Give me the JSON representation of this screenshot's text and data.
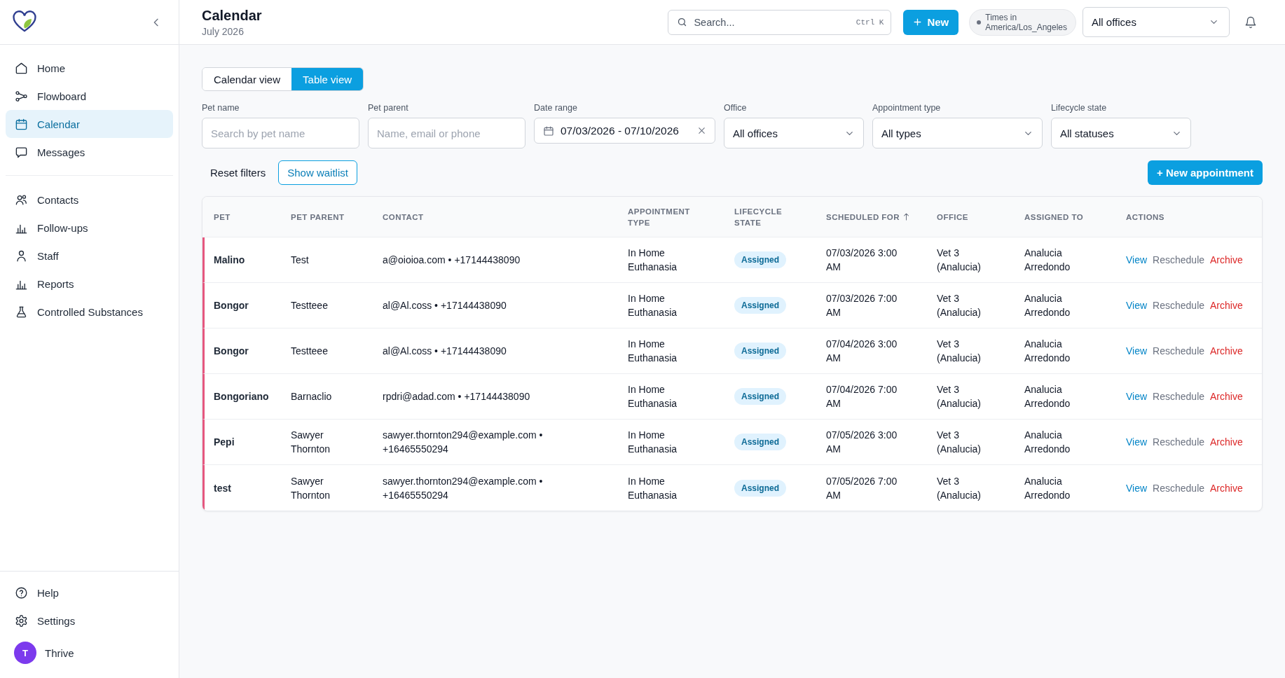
{
  "sidebar": {
    "sections": [
      {
        "items": [
          {
            "label": "Home",
            "selected": false
          },
          {
            "label": "Flowboard",
            "selected": false
          },
          {
            "label": "Calendar",
            "selected": true
          },
          {
            "label": "Messages",
            "selected": false
          }
        ]
      },
      {
        "items": [
          {
            "label": "Contacts",
            "selected": false
          },
          {
            "label": "Follow-ups",
            "selected": false
          },
          {
            "label": "Staff",
            "selected": false
          },
          {
            "label": "Reports",
            "selected": false
          },
          {
            "label": "Controlled Substances",
            "selected": false
          }
        ]
      }
    ],
    "footer_items": [
      {
        "label": "Help",
        "selected": false
      },
      {
        "label": "Settings",
        "selected": false
      }
    ],
    "user": {
      "initial": "T",
      "name": "Thrive"
    }
  },
  "header": {
    "title": "Calendar",
    "subtitle": "July 2026",
    "search": {
      "placeholder": "Search...",
      "shortcut": "Ctrl K"
    },
    "new_button": "New",
    "timezone": "Times in America/Los_Angeles",
    "office_select": "All offices"
  },
  "view_toggle": [
    {
      "label": "Calendar view",
      "selected": false
    },
    {
      "label": "Table view",
      "selected": true
    }
  ],
  "filters": [
    {
      "label": "Pet name",
      "kind": "text",
      "placeholder": "Search by pet name"
    },
    {
      "label": "Pet parent",
      "kind": "text",
      "placeholder": "Name, email or phone"
    },
    {
      "label": "Date range",
      "kind": "date",
      "value": "07/03/2026 - 07/10/2026"
    },
    {
      "label": "Office",
      "kind": "select",
      "value": "All offices"
    },
    {
      "label": "Appointment type",
      "kind": "select",
      "value": "All types"
    },
    {
      "label": "Lifecycle state",
      "kind": "select",
      "value": "All statuses"
    }
  ],
  "filter_actions": {
    "reset": "Reset filters",
    "waitlist": "Show waitlist",
    "new_appointment": "+ New appointment"
  },
  "table": {
    "columns": [
      {
        "label": "PET",
        "sorted": false
      },
      {
        "label": "PET PARENT",
        "sorted": false
      },
      {
        "label": "CONTACT",
        "sorted": false
      },
      {
        "label": "APPOINTMENT TYPE",
        "sorted": false
      },
      {
        "label": "LIFECYCLE STATE",
        "sorted": false
      },
      {
        "label": "SCHEDULED FOR",
        "sorted": true
      },
      {
        "label": "OFFICE",
        "sorted": false
      },
      {
        "label": "ASSIGNED TO",
        "sorted": false
      },
      {
        "label": "ACTIONS",
        "sorted": false
      }
    ],
    "rows": [
      {
        "pet": "Malino",
        "pet_parent": "Test",
        "contact": "a@oioioa.com • +17144438090",
        "appointment_type": "In Home Euthanasia",
        "lifecycle_state": "Assigned",
        "scheduled_for": "07/03/2026 3:00 AM",
        "office": "Vet 3 (Analucia)",
        "assigned_to": "Analucia Arredondo",
        "actions": [
          {
            "label": "View",
            "kind": "primary"
          },
          {
            "label": "Reschedule",
            "kind": "secondary"
          },
          {
            "label": "Archive",
            "kind": "danger"
          }
        ]
      },
      {
        "pet": "Bongor",
        "pet_parent": "Testteee",
        "contact": "al@Al.coss • +17144438090",
        "appointment_type": "In Home Euthanasia",
        "lifecycle_state": "Assigned",
        "scheduled_for": "07/03/2026 7:00 AM",
        "office": "Vet 3 (Analucia)",
        "assigned_to": "Analucia Arredondo",
        "actions": [
          {
            "label": "View",
            "kind": "primary"
          },
          {
            "label": "Reschedule",
            "kind": "secondary"
          },
          {
            "label": "Archive",
            "kind": "danger"
          }
        ]
      },
      {
        "pet": "Bongor",
        "pet_parent": "Testteee",
        "contact": "al@Al.coss • +17144438090",
        "appointment_type": "In Home Euthanasia",
        "lifecycle_state": "Assigned",
        "scheduled_for": "07/04/2026 3:00 AM",
        "office": "Vet 3 (Analucia)",
        "assigned_to": "Analucia Arredondo",
        "actions": [
          {
            "label": "View",
            "kind": "primary"
          },
          {
            "label": "Reschedule",
            "kind": "secondary"
          },
          {
            "label": "Archive",
            "kind": "danger"
          }
        ]
      },
      {
        "pet": "Bongoriano",
        "pet_parent": "Barnaclio",
        "contact": "rpdri@adad.com • +17144438090",
        "appointment_type": "In Home Euthanasia",
        "lifecycle_state": "Assigned",
        "scheduled_for": "07/04/2026 7:00 AM",
        "office": "Vet 3 (Analucia)",
        "assigned_to": "Analucia Arredondo",
        "actions": [
          {
            "label": "View",
            "kind": "primary"
          },
          {
            "label": "Reschedule",
            "kind": "secondary"
          },
          {
            "label": "Archive",
            "kind": "danger"
          }
        ]
      },
      {
        "pet": "Pepi",
        "pet_parent": "Sawyer Thornton",
        "contact": "sawyer.thornton294@example.com • +16465550294",
        "appointment_type": "In Home Euthanasia",
        "lifecycle_state": "Assigned",
        "scheduled_for": "07/05/2026 3:00 AM",
        "office": "Vet 3 (Analucia)",
        "assigned_to": "Analucia Arredondo",
        "actions": [
          {
            "label": "View",
            "kind": "primary"
          },
          {
            "label": "Reschedule",
            "kind": "secondary"
          },
          {
            "label": "Archive",
            "kind": "danger"
          }
        ]
      },
      {
        "pet": "test",
        "pet_parent": "Sawyer Thornton",
        "contact": "sawyer.thornton294@example.com • +16465550294",
        "appointment_type": "In Home Euthanasia",
        "lifecycle_state": "Assigned",
        "scheduled_for": "07/05/2026 7:00 AM",
        "office": "Vet 3 (Analucia)",
        "assigned_to": "Analucia Arredondo",
        "actions": [
          {
            "label": "View",
            "kind": "primary"
          },
          {
            "label": "Reschedule",
            "kind": "secondary"
          },
          {
            "label": "Archive",
            "kind": "danger"
          }
        ]
      }
    ]
  }
}
